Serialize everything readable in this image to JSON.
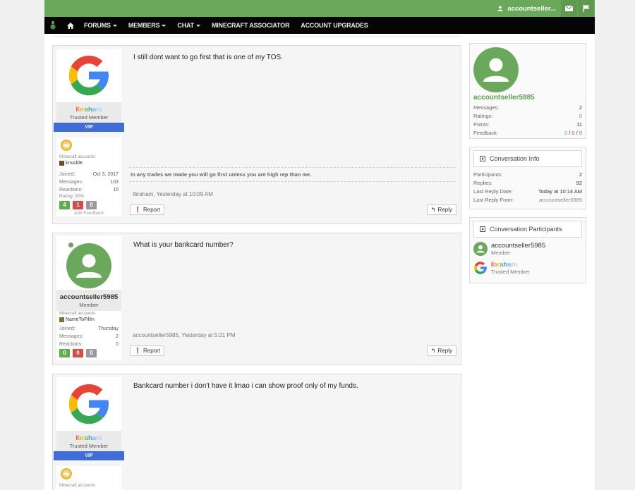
{
  "header": {
    "username": "accountseller...",
    "icons": [
      "user-icon",
      "envelope-icon",
      "flag-icon"
    ]
  },
  "nav": {
    "items": [
      {
        "label": "FORUMS",
        "dropdown": true
      },
      {
        "label": "MEMBERS",
        "dropdown": true
      },
      {
        "label": "CHAT",
        "dropdown": true
      },
      {
        "label": "MINECRAFT ASSOCIATOR",
        "dropdown": false
      },
      {
        "label": "ACCOUNT UPGRADES",
        "dropdown": false
      }
    ]
  },
  "messages": [
    {
      "author": "Ibraham",
      "author_title": "Trusted Member",
      "banner": "VIP",
      "mc_label": "Minecraft accounts:",
      "mc_name": "knuckle",
      "joined_label": "Joined:",
      "joined": "Oct 3, 2017",
      "messages_label": "Messages:",
      "messages": "103",
      "reactions_label": "Reactions:",
      "reactions": "15",
      "rating_label": "Rating: 80%",
      "feedback": [
        "4",
        "1",
        "0"
      ],
      "add_feedback": "Add Feedback",
      "text": "I still dont want to go first that is one of my TOS.",
      "signature": "In any trades we made you will go first unless you are high rep than me.",
      "meta": "Ibraham, Yesterday at 10:09 AM",
      "report": "Report",
      "reply": "Reply"
    },
    {
      "author": "accountseller5985",
      "author_title": "Member",
      "mc_label": "Minecraft accounts:",
      "mc_name": "NameToFillIn",
      "joined_label": "Joined:",
      "joined": "Thursday",
      "messages_label": "Messages:",
      "messages": "2",
      "reactions_label": "Reactions:",
      "reactions": "0",
      "feedback": [
        "0",
        "0",
        "0"
      ],
      "text": "What is your bankcard number?",
      "meta": "accountseller5985, Yesterday at 5:21 PM",
      "report": "Report",
      "reply": "Reply"
    },
    {
      "author": "Ibraham",
      "author_title": "Trusted Member",
      "banner": "VIP",
      "mc_label": "Minecraft accounts:",
      "text": "Bankcard number i don't have it lmao i can show proof only of my funds."
    }
  ],
  "sidebar": {
    "profile": {
      "name": "accountseller5985",
      "stats": [
        {
          "k": "Messages:",
          "v": "2"
        },
        {
          "k": "Ratings:",
          "v": "0"
        },
        {
          "k": "Points:",
          "v": "11"
        }
      ],
      "feedback_label": "Feedback:",
      "feedback": [
        "0",
        "0",
        "0"
      ]
    },
    "conversation_info": {
      "title": "Conversation Info",
      "rows": [
        {
          "k": "Participants:",
          "v": "2"
        },
        {
          "k": "Replies:",
          "v": "92"
        },
        {
          "k": "Last Reply Date:",
          "v": "Today at 10:14 AM"
        },
        {
          "k": "Last Reply From:",
          "v": "accountseller5985"
        }
      ]
    },
    "participants": {
      "title": "Conversation Participants",
      "list": [
        {
          "name": "accountseller5985",
          "title": "Member"
        },
        {
          "name": "Ibraham",
          "title": "Trusted Member"
        }
      ]
    }
  },
  "colors": {
    "brand_green": "#6aa95c",
    "nav_black": "#050505",
    "vip_blue": "#3f6ed8",
    "feedback_green": "#5fae4b",
    "feedback_red": "#d74b40",
    "feedback_gray": "#9a9a9a",
    "profile_green": "#5a9e4c"
  }
}
